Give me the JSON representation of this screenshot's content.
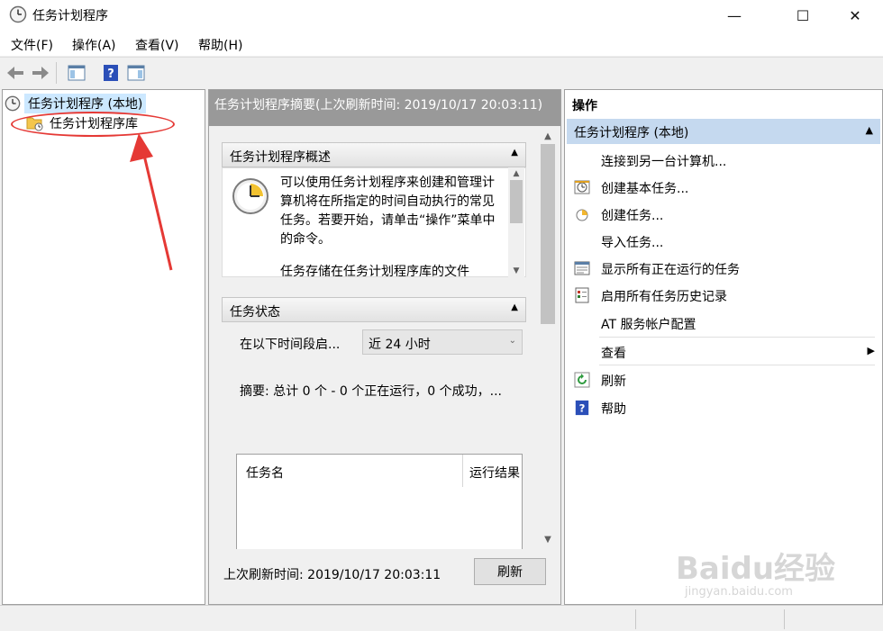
{
  "window": {
    "title": "任务计划程序",
    "minimize": "—",
    "maximize": "☐",
    "close": "✕"
  },
  "menu": [
    "文件(F)",
    "操作(A)",
    "查看(V)",
    "帮助(H)"
  ],
  "tree": {
    "root": "任务计划程序 (本地)",
    "child": "任务计划程序库"
  },
  "summary": {
    "header": "任务计划程序摘要(上次刷新时间: 2019/10/17 20:03:11)",
    "overview_title": "任务计划程序概述",
    "overview_text": "可以使用任务计划程序来创建和管理计算机将在所指定的时间自动执行的常见任务。若要开始，请单击“操作”菜单中的命令。",
    "overview_text2": "任务存储在任务计划程序库的文件",
    "status_title": "任务状态",
    "status_label": "在以下时间段启...",
    "status_value": "近 24 小时",
    "status_summary": "摘要: 总计 0 个 - 0 个正在运行，0 个成功，...",
    "table_headers": [
      "任务名",
      "运行结果"
    ],
    "last_refresh": "上次刷新时间: 2019/10/17 20:03:11",
    "refresh_button": "刷新"
  },
  "actions": {
    "title": "操作",
    "group": "任务计划程序 (本地)",
    "items": [
      {
        "label": "连接到另一台计算机...",
        "icon": ""
      },
      {
        "label": "创建基本任务...",
        "icon": "basic-task-icon"
      },
      {
        "label": "创建任务...",
        "icon": "create-task-icon"
      },
      {
        "label": "导入任务...",
        "icon": ""
      },
      {
        "label": "显示所有正在运行的任务",
        "icon": "running-tasks-icon"
      },
      {
        "label": "启用所有任务历史记录",
        "icon": "history-icon"
      },
      {
        "label": "AT 服务帐户配置",
        "icon": ""
      },
      {
        "label": "查看",
        "icon": ""
      },
      {
        "label": "刷新",
        "icon": "refresh-icon"
      },
      {
        "label": "帮助",
        "icon": "help-icon"
      }
    ]
  },
  "watermark": {
    "brand": "Baidu经验",
    "url": "jingyan.baidu.com"
  },
  "colors": {
    "selection": "#cce8ff",
    "actions_group": "#c5d9ef",
    "annotation": "#e53935"
  }
}
